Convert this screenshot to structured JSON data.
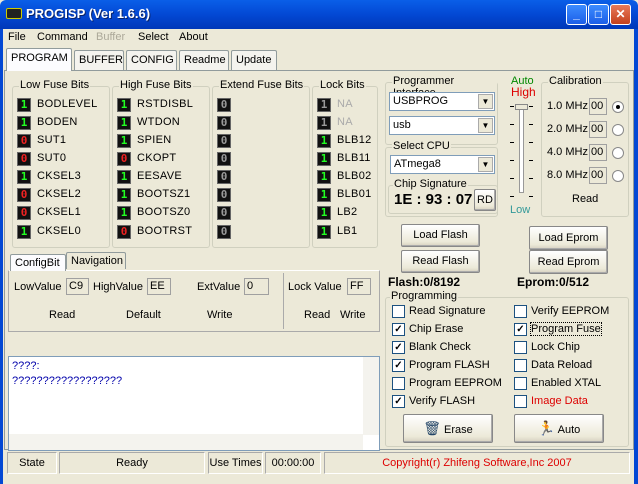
{
  "window": {
    "title": "PROGISP (Ver 1.6.6)",
    "min": "_",
    "max": "□",
    "close": "✕"
  },
  "menu": [
    "File",
    "Command",
    "Buffer",
    "Select",
    "About"
  ],
  "tabs": [
    "PROGRAM",
    "BUFFER",
    "CONFIG",
    "Readme",
    "Update"
  ],
  "fuses": {
    "low": {
      "title": "Low Fuse Bits",
      "bits": [
        {
          "v": "1",
          "n": "BODLEVEL"
        },
        {
          "v": "1",
          "n": "BODEN"
        },
        {
          "v": "0",
          "n": "SUT1"
        },
        {
          "v": "0",
          "n": "SUT0"
        },
        {
          "v": "1",
          "n": "CKSEL3"
        },
        {
          "v": "0",
          "n": "CKSEL2"
        },
        {
          "v": "0",
          "n": "CKSEL1"
        },
        {
          "v": "1",
          "n": "CKSEL0"
        }
      ]
    },
    "high": {
      "title": "High Fuse Bits",
      "bits": [
        {
          "v": "1",
          "n": "RSTDISBL"
        },
        {
          "v": "1",
          "n": "WTDON"
        },
        {
          "v": "1",
          "n": "SPIEN"
        },
        {
          "v": "0",
          "n": "CKOPT"
        },
        {
          "v": "1",
          "n": "EESAVE"
        },
        {
          "v": "1",
          "n": "BOOTSZ1"
        },
        {
          "v": "1",
          "n": "BOOTSZ0"
        },
        {
          "v": "0",
          "n": "BOOTRST"
        }
      ]
    },
    "ext": {
      "title": "Extend Fuse Bits",
      "bits": [
        {
          "v": "0",
          "n": ""
        },
        {
          "v": "0",
          "n": ""
        },
        {
          "v": "0",
          "n": ""
        },
        {
          "v": "0",
          "n": ""
        },
        {
          "v": "0",
          "n": ""
        },
        {
          "v": "0",
          "n": ""
        },
        {
          "v": "0",
          "n": ""
        },
        {
          "v": "0",
          "n": ""
        }
      ]
    },
    "lock": {
      "title": "Lock Bits",
      "bits": [
        {
          "v": "1",
          "n": "NA"
        },
        {
          "v": "1",
          "n": "NA"
        },
        {
          "v": "1",
          "n": "BLB12"
        },
        {
          "v": "1",
          "n": "BLB11"
        },
        {
          "v": "1",
          "n": "BLB02"
        },
        {
          "v": "1",
          "n": "BLB01"
        },
        {
          "v": "1",
          "n": "LB2"
        },
        {
          "v": "1",
          "n": "LB1"
        }
      ]
    }
  },
  "subtabs": [
    "ConfigBit",
    "Navigation"
  ],
  "values": {
    "low_label": "LowValue",
    "low": "C9",
    "high_label": "HighValue",
    "high": "EE",
    "ext_label": "ExtValue",
    "ext": "0",
    "lock_label": "Lock Value",
    "lock": "FF",
    "read": "Read",
    "default": "Default",
    "write": "Write",
    "lock_read": "Read",
    "lock_write": "Write"
  },
  "log": [
    "????:",
    "??????????????????"
  ],
  "status": {
    "state": "State",
    "ready": "Ready",
    "use_times": "Use Times",
    "time": "00:00:00",
    "copyright": "Copyright(r) Zhifeng Software,Inc 2007"
  },
  "programmer": {
    "title": "Programmer Interface",
    "device": "USBPROG",
    "port": "usb"
  },
  "cpu": {
    "title": "Select CPU",
    "value": "ATmega8",
    "sig_title": "Chip Signature",
    "signature": "1E : 93 : 07",
    "rd": "RD"
  },
  "slider": {
    "auto": "Auto",
    "high": "High",
    "low": "Low",
    "level": 1.0
  },
  "calibration": {
    "title": "Calibration",
    "rows": [
      {
        "f": "1.0 MHz",
        "v": "00",
        "sel": true
      },
      {
        "f": "2.0 MHz",
        "v": "00",
        "sel": false
      },
      {
        "f": "4.0 MHz",
        "v": "00",
        "sel": false
      },
      {
        "f": "8.0 MHz",
        "v": "00",
        "sel": false
      }
    ],
    "read": "Read"
  },
  "buttons": {
    "load_flash": "Load Flash",
    "read_flash": "Read Flash",
    "load_eprom": "Load Eprom",
    "read_eprom": "Read Eprom",
    "erase": "Erase",
    "auto": "Auto"
  },
  "flash": "Flash:0/8192",
  "eprom": "Eprom:0/512",
  "programming": {
    "title": "Programming",
    "left": [
      {
        "l": "Read Signature",
        "c": false
      },
      {
        "l": "Chip Erase",
        "c": true
      },
      {
        "l": "Blank Check",
        "c": true
      },
      {
        "l": "Program FLASH",
        "c": true
      },
      {
        "l": "Program EEPROM",
        "c": false
      },
      {
        "l": "Verify FLASH",
        "c": true
      }
    ],
    "right": [
      {
        "l": "Verify EEPROM",
        "c": false
      },
      {
        "l": "Program Fuse",
        "c": true
      },
      {
        "l": "Lock Chip",
        "c": false
      },
      {
        "l": "Data Reload",
        "c": false
      },
      {
        "l": "Enabled XTAL",
        "c": false
      },
      {
        "l": "Image Data",
        "c": false
      }
    ]
  },
  "colors": {
    "title_bar": "#0348D4",
    "bit_on": "#22ff22",
    "bit_off": "#ee2222",
    "log_text": "#0000aa",
    "copyright": "#dd0000"
  }
}
